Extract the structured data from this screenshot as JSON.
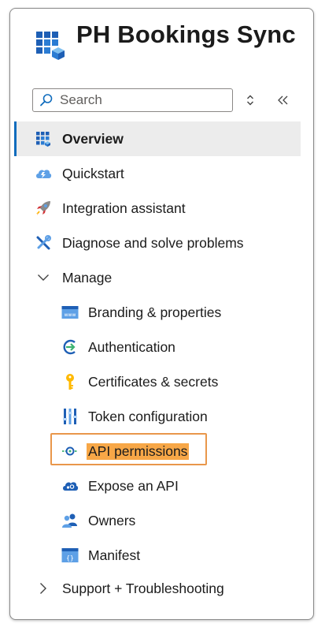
{
  "app": {
    "title": "PH Bookings Sync"
  },
  "search": {
    "placeholder": "Search",
    "value": ""
  },
  "menu": {
    "overview": "Overview",
    "quickstart": "Quickstart",
    "integration_assistant": "Integration assistant",
    "diagnose": "Diagnose and solve problems",
    "manage": "Manage",
    "branding": "Branding & properties",
    "authentication": "Authentication",
    "certificates": "Certificates & secrets",
    "token_configuration": "Token configuration",
    "api_permissions": "API permissions",
    "expose_api": "Expose an API",
    "owners": "Owners",
    "manifest": "Manifest",
    "support": "Support + Troubleshooting"
  },
  "state": {
    "selected": "Overview",
    "highlighted": "API permissions"
  },
  "colors": {
    "selected_bg": "#ececec",
    "accent": "#0f6cbd",
    "highlight": "#f7a747",
    "highlight_border": "#e9974b"
  }
}
